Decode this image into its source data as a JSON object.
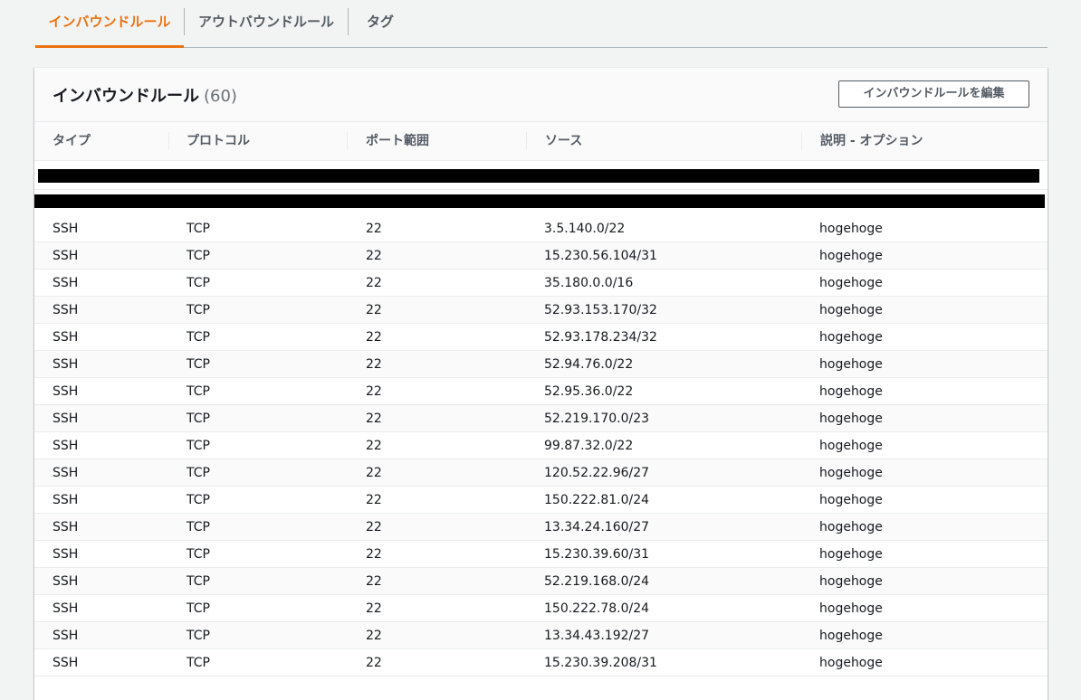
{
  "tabs": [
    {
      "label": "インバウンドルール",
      "active": true
    },
    {
      "label": "アウトバウンドルール",
      "active": false
    },
    {
      "label": "タグ",
      "active": false
    }
  ],
  "panel": {
    "title": "インバウンドルール",
    "count": "(60)",
    "edit_button": "インバウンドルールを編集"
  },
  "columns": [
    "タイプ",
    "プロトコル",
    "ポート範囲",
    "ソース",
    "説明 - オプション"
  ],
  "rows": [
    [
      "SSH",
      "TCP",
      "22",
      "3.5.140.0/22",
      "hogehoge"
    ],
    [
      "SSH",
      "TCP",
      "22",
      "15.230.56.104/31",
      "hogehoge"
    ],
    [
      "SSH",
      "TCP",
      "22",
      "35.180.0.0/16",
      "hogehoge"
    ],
    [
      "SSH",
      "TCP",
      "22",
      "52.93.153.170/32",
      "hogehoge"
    ],
    [
      "SSH",
      "TCP",
      "22",
      "52.93.178.234/32",
      "hogehoge"
    ],
    [
      "SSH",
      "TCP",
      "22",
      "52.94.76.0/22",
      "hogehoge"
    ],
    [
      "SSH",
      "TCP",
      "22",
      "52.95.36.0/22",
      "hogehoge"
    ],
    [
      "SSH",
      "TCP",
      "22",
      "52.219.170.0/23",
      "hogehoge"
    ],
    [
      "SSH",
      "TCP",
      "22",
      "99.87.32.0/22",
      "hogehoge"
    ],
    [
      "SSH",
      "TCP",
      "22",
      "120.52.22.96/27",
      "hogehoge"
    ],
    [
      "SSH",
      "TCP",
      "22",
      "150.222.81.0/24",
      "hogehoge"
    ],
    [
      "SSH",
      "TCP",
      "22",
      "13.34.24.160/27",
      "hogehoge"
    ],
    [
      "SSH",
      "TCP",
      "22",
      "15.230.39.60/31",
      "hogehoge"
    ],
    [
      "SSH",
      "TCP",
      "22",
      "52.219.168.0/24",
      "hogehoge"
    ],
    [
      "SSH",
      "TCP",
      "22",
      "150.222.78.0/24",
      "hogehoge"
    ],
    [
      "SSH",
      "TCP",
      "22",
      "13.34.43.192/27",
      "hogehoge"
    ],
    [
      "SSH",
      "TCP",
      "22",
      "15.230.39.208/31",
      "hogehoge"
    ]
  ],
  "colors": {
    "accent": "#ec7211",
    "text": "#16191f",
    "muted": "#545b64"
  }
}
